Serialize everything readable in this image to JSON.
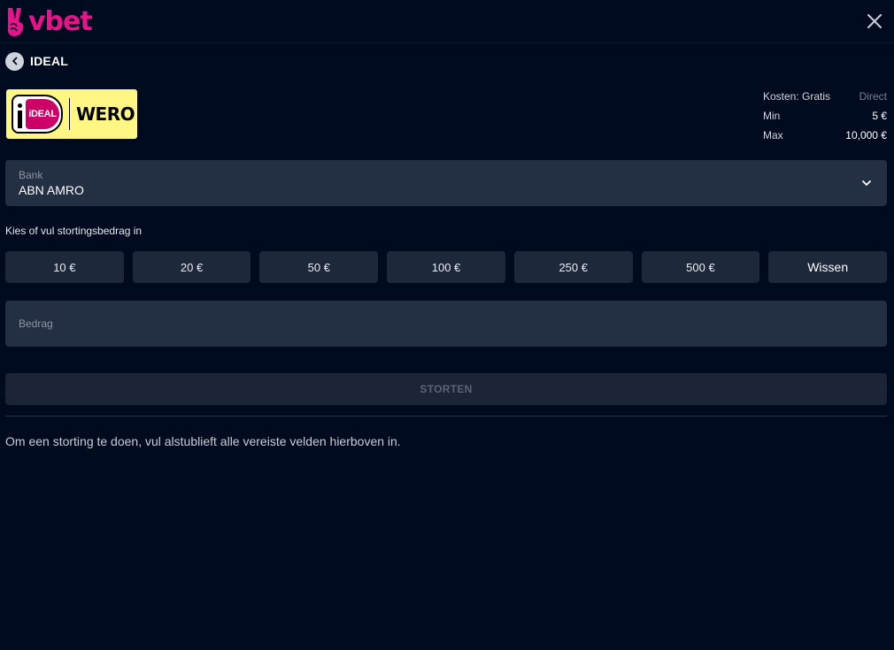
{
  "header": {
    "logo_text": "vbet",
    "brand_color": "#e8138b"
  },
  "payment": {
    "title": "IDEAL",
    "provider_logo": {
      "ideal_text": "iDEAL",
      "wero_text": "WERO"
    },
    "info": {
      "fee_label": "Kosten: Gratis",
      "speed_value": "Direct",
      "min_label": "Min",
      "min_value": "5 €",
      "max_label": "Max",
      "max_value": "10,000 €"
    }
  },
  "bank": {
    "label": "Bank",
    "selected": "ABN AMRO"
  },
  "amount": {
    "prompt": "Kies of vul stortingsbedrag in",
    "presets": [
      "10 €",
      "20 €",
      "50 €",
      "100 €",
      "250 €",
      "500 €"
    ],
    "clear_label": "Wissen",
    "input_placeholder": "Bedrag"
  },
  "submit_label": "STORTEN",
  "help_text": "Om een storting te doen, vul alstublieft alle vereiste velden hierboven in.",
  "icons": {
    "close": "close-icon",
    "back": "chevron-left-icon",
    "dropdown": "chevron-down-icon"
  }
}
